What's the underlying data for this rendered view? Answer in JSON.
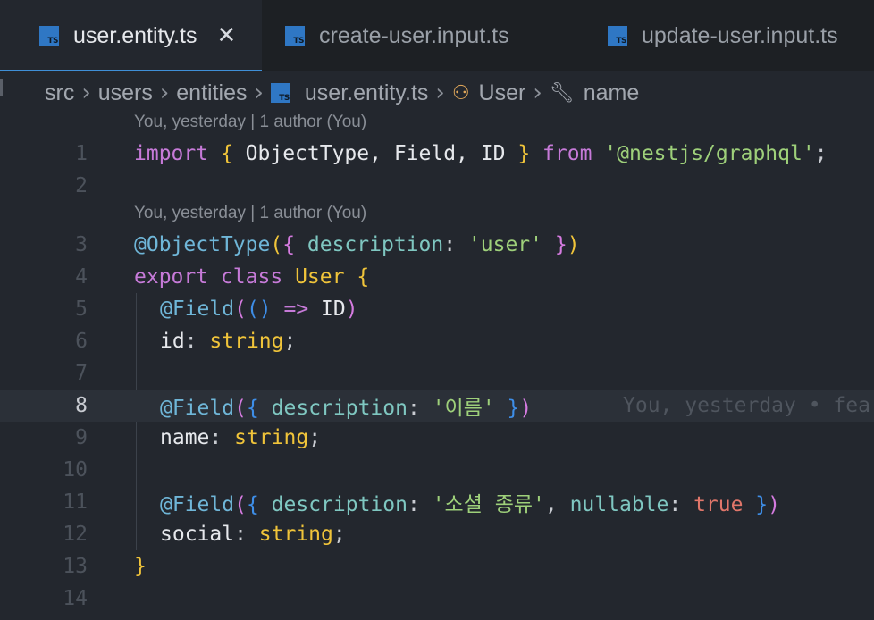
{
  "tabs": [
    {
      "label": "user.entity.ts",
      "active": true,
      "closable": true
    },
    {
      "label": "create-user.input.ts",
      "active": false
    },
    {
      "label": "update-user.input.ts",
      "active": false
    }
  ],
  "breadcrumb": {
    "parts": [
      "src",
      "users",
      "entities"
    ],
    "file": "user.entity.ts",
    "class": "User",
    "member": "name"
  },
  "codelens": [
    "You, yesterday | 1 author (You)",
    "You, yesterday | 1 author (You)"
  ],
  "inline_blame": "You, yesterday • fea",
  "line_numbers": [
    "1",
    "2",
    "3",
    "4",
    "5",
    "6",
    "7",
    "8",
    "9",
    "10",
    "11",
    "12",
    "13",
    "14"
  ],
  "current_line": "8",
  "code": {
    "l1": {
      "import": "import",
      "ob": "{",
      "names": " ObjectType, Field, ID ",
      "cb": "}",
      "from": "from",
      "module": "'@nestjs/graphql'",
      "semi": ";"
    },
    "l3": {
      "decorator": "@ObjectType",
      "op": "(",
      "ob": "{",
      "key": " description",
      "colon": ": ",
      "val": "'user'",
      "cb": " }",
      "cp": ")"
    },
    "l4": {
      "export": "export",
      "class": "class",
      "name": "User",
      "ob": "{"
    },
    "l5": {
      "decorator": "@Field",
      "op": "(",
      "inner": "()",
      "arrow": " => ",
      "id": "ID",
      "cp": ")"
    },
    "l6": {
      "prop": "id",
      "colon": ": ",
      "type": "string",
      "semi": ";"
    },
    "l8": {
      "decorator": "@Field",
      "op": "(",
      "ob": "{",
      "key": " description",
      "colon": ": ",
      "val": "'이름'",
      "cb": " }",
      "cp": ")"
    },
    "l9": {
      "prop": "name",
      "colon": ": ",
      "type": "string",
      "semi": ";"
    },
    "l11": {
      "decorator": "@Field",
      "op": "(",
      "ob": "{",
      "key": " description",
      "colon": ": ",
      "val": "'소셜 종류'",
      "comma": ", ",
      "key2": "nullable",
      "colon2": ": ",
      "val2": "true",
      "cb": " }",
      "cp": ")"
    },
    "l12": {
      "prop": "social",
      "colon": ": ",
      "type": "string",
      "semi": ";"
    },
    "l13": {
      "cb": "}"
    }
  }
}
